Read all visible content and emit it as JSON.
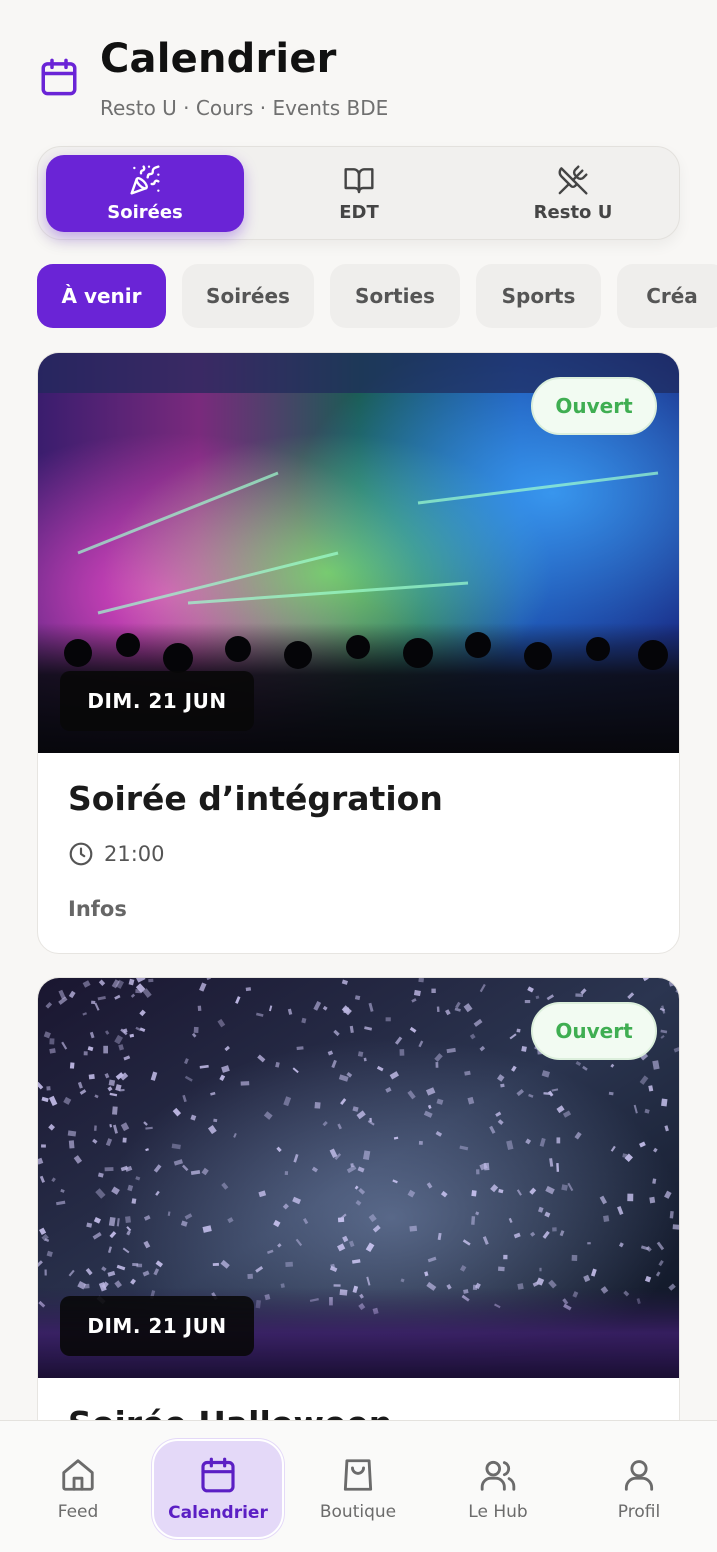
{
  "header": {
    "title": "Calendrier",
    "subtitle": "Resto U · Cours · Events BDE",
    "icon": "calendar-icon"
  },
  "segments": [
    {
      "label": "Soirées",
      "icon": "party-popper-icon",
      "active": true
    },
    {
      "label": "EDT",
      "icon": "book-open-icon",
      "active": false
    },
    {
      "label": "Resto U",
      "icon": "utensils-crossed-icon",
      "active": false
    }
  ],
  "chips": [
    {
      "label": "À venir",
      "active": true
    },
    {
      "label": "Soirées",
      "active": false
    },
    {
      "label": "Sorties",
      "active": false
    },
    {
      "label": "Sports",
      "active": false
    },
    {
      "label": "Créa",
      "active": false
    }
  ],
  "events": [
    {
      "title": "Soirée d’intégration",
      "date": "DIM. 21 JUN",
      "status": "Ouvert",
      "time": "21:00",
      "info_label": "Infos"
    },
    {
      "title": "Soirée Halloween",
      "date": "DIM. 21 JUN",
      "status": "Ouvert",
      "time": "",
      "info_label": ""
    }
  ],
  "nav": [
    {
      "label": "Feed",
      "icon": "home-icon",
      "active": false
    },
    {
      "label": "Calendrier",
      "icon": "calendar-icon",
      "active": true
    },
    {
      "label": "Boutique",
      "icon": "shopping-bag-icon",
      "active": false
    },
    {
      "label": "Le Hub",
      "icon": "users-icon",
      "active": false
    },
    {
      "label": "Profil",
      "icon": "user-icon",
      "active": false
    }
  ],
  "colors": {
    "accent": "#6a24d6",
    "open_badge_text": "#3fae52",
    "background": "#f8f7f5"
  }
}
